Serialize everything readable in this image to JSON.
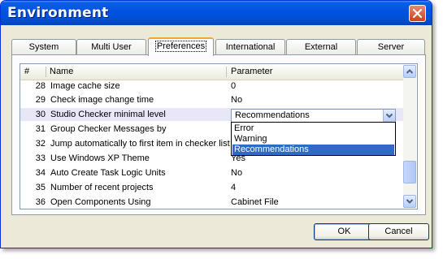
{
  "window": {
    "title": "Environment"
  },
  "tabs": [
    {
      "label": "System"
    },
    {
      "label": "Multi User"
    },
    {
      "label": "Preferences"
    },
    {
      "label": "International"
    },
    {
      "label": "External"
    },
    {
      "label": "Server"
    }
  ],
  "active_tab": "Preferences",
  "columns": {
    "num": "#",
    "name": "Name",
    "param": "Parameter"
  },
  "rows": [
    {
      "num": "28",
      "name": "Image cache size",
      "value": "0"
    },
    {
      "num": "29",
      "name": "Check image change time",
      "value": "No"
    },
    {
      "num": "30",
      "name": "Studio Checker minimal level",
      "value": ""
    },
    {
      "num": "31",
      "name": "Group Checker Messages by",
      "value": ""
    },
    {
      "num": "32",
      "name": "Jump automatically to first item in checker list",
      "value": ""
    },
    {
      "num": "33",
      "name": "Use Windows XP Theme",
      "value": "Yes"
    },
    {
      "num": "34",
      "name": "Auto Create Task Logic Units",
      "value": "No"
    },
    {
      "num": "35",
      "name": "Number of recent projects",
      "value": "4"
    },
    {
      "num": "36",
      "name": "Open Components Using",
      "value": "Cabinet File"
    }
  ],
  "combo": {
    "selected": "Recommendations",
    "options": [
      "Error",
      "Warning",
      "Recommendations"
    ],
    "highlighted": "Recommendations"
  },
  "buttons": {
    "ok": "OK",
    "cancel": "Cancel"
  },
  "colors": {
    "title_bar": "#0054e3",
    "selection": "#316ac5",
    "active_tab_accent": "#f1a53b",
    "close_button": "#d0401a"
  }
}
